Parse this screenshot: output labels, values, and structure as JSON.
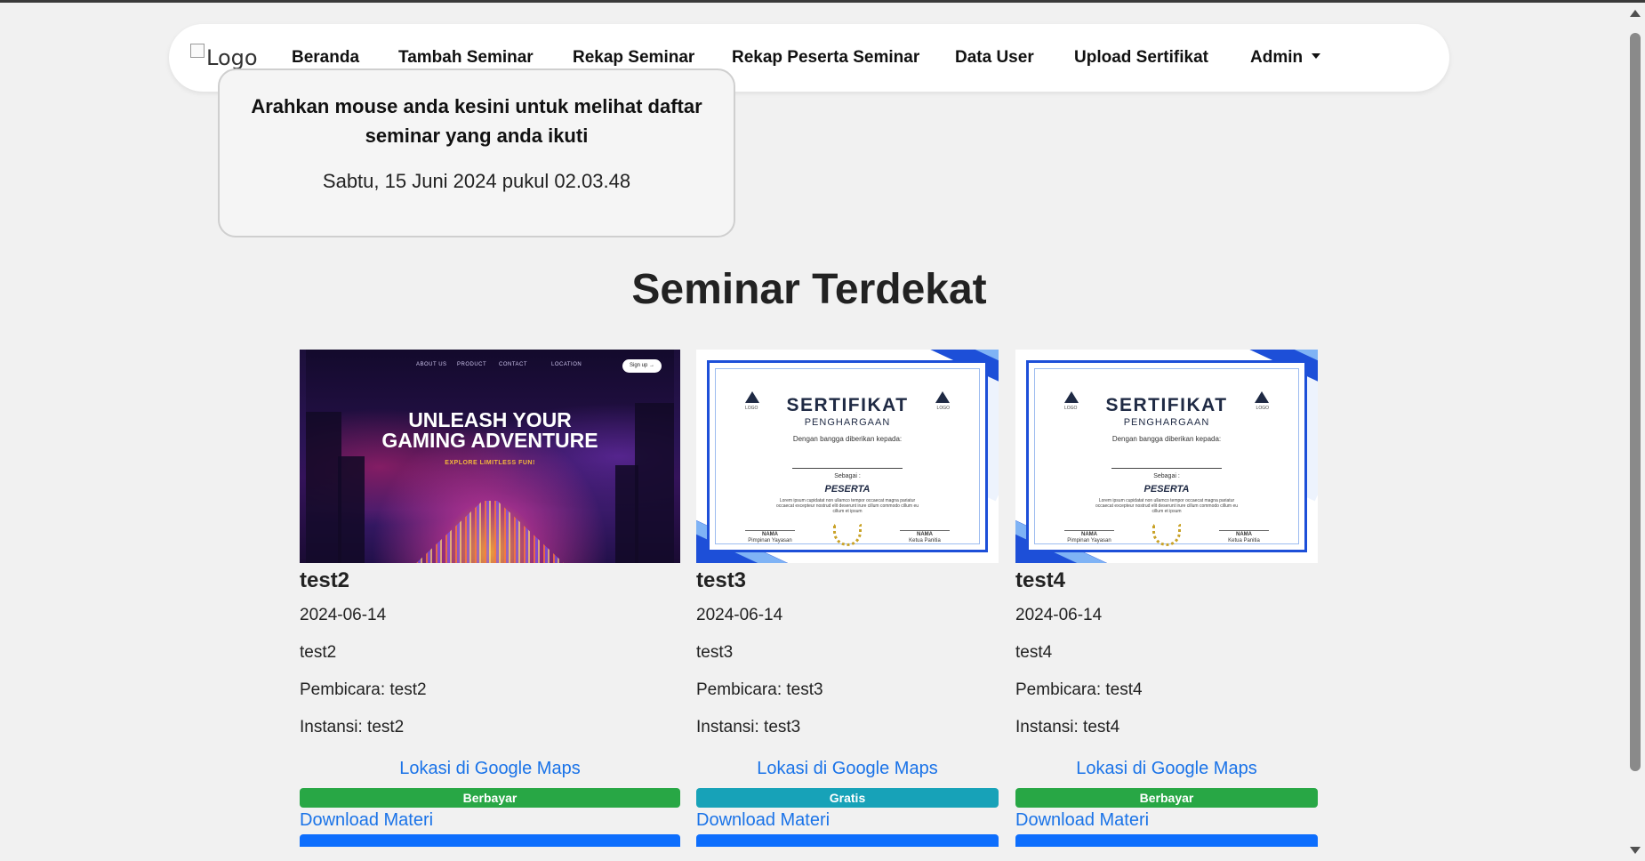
{
  "navbar": {
    "logo_alt": "Logo",
    "items": [
      {
        "label": "Beranda"
      },
      {
        "label": "Tambah Seminar"
      },
      {
        "label": "Rekap Seminar"
      },
      {
        "label": "Rekap Peserta Seminar"
      },
      {
        "label": "Data User"
      },
      {
        "label": "Upload Sertifikat"
      },
      {
        "label": "Admin"
      }
    ]
  },
  "hover_box": {
    "title": "Arahkan mouse anda kesini untuk melihat daftar seminar yang anda ikuti",
    "datetime": "Sabtu, 15 Juni 2024 pukul 02.03.48"
  },
  "section_title": "Seminar Terdekat",
  "cards": [
    {
      "title": "test2",
      "date": "2024-06-14",
      "description": "test2",
      "speaker": "Pembicara: test2",
      "institution": "Instansi: test2",
      "maps_link": "Lokasi di Google Maps",
      "badge": "Berbayar",
      "badge_color": "#28a745",
      "download": "Download Materi",
      "thumbnail": {
        "nav": [
          "ABOUT US",
          "PRODUCT",
          "CONTACT",
          "LOCATION"
        ],
        "signup": "Sign up →",
        "headline_1": "UNLEASH YOUR",
        "headline_2": "GAMING ADVENTURE",
        "subline": "EXPLORE LIMITLESS FUN!"
      }
    },
    {
      "title": "test3",
      "date": "2024-06-14",
      "description": "test3",
      "speaker": "Pembicara: test3",
      "institution": "Instansi: test3",
      "maps_link": "Lokasi di Google Maps",
      "badge": "Gratis",
      "badge_color": "#17a2b8",
      "download": "Download Materi",
      "thumbnail": {
        "title": "SERTIFIKAT",
        "subtitle": "PENGHARGAAN",
        "given": "Dengan bangga diberikan kepada:",
        "as": "Sebagai :",
        "role": "PESERTA",
        "lorem": "Lorem ipsum cupidatat non ullamco tempor occaecat magna pariatur occaecat excepteur nostrud elit deserunt irure cillum commodo cillum eu cillum et ipsum",
        "logo_text": "LOGO",
        "sig_left_name": "NAMA",
        "sig_left_role": "Pimpinan Yayasan",
        "sig_right_name": "NAMA",
        "sig_right_role": "Ketua Panitia"
      }
    },
    {
      "title": "test4",
      "date": "2024-06-14",
      "description": "test4",
      "speaker": "Pembicara: test4",
      "institution": "Instansi: test4",
      "maps_link": "Lokasi di Google Maps",
      "badge": "Berbayar",
      "badge_color": "#28a745",
      "download": "Download Materi",
      "thumbnail": {
        "title": "SERTIFIKAT",
        "subtitle": "PENGHARGAAN",
        "given": "Dengan bangga diberikan kepada:",
        "as": "Sebagai :",
        "role": "PESERTA",
        "lorem": "Lorem ipsum cupidatat non ullamco tempor occaecat magna pariatur occaecat excepteur nostrud elit deserunt irure cillum commodo cillum eu cillum et ipsum",
        "logo_text": "LOGO",
        "sig_left_name": "NAMA",
        "sig_left_role": "Pimpinan Yayasan",
        "sig_right_name": "NAMA",
        "sig_right_role": "Ketua Panitia"
      }
    }
  ],
  "colors": {
    "accent_blue": "#0d6efd",
    "link_blue": "#1a73e8",
    "background": "#f1f1f1"
  }
}
